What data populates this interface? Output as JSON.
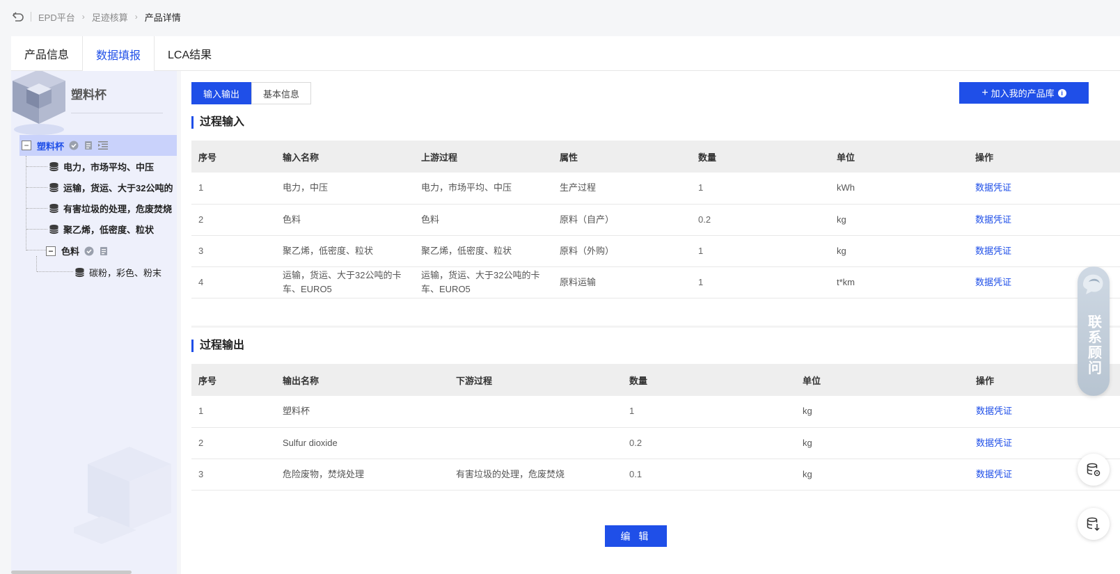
{
  "breadcrumb": {
    "items": [
      "EPD平台",
      "足迹核算",
      "产品详情"
    ]
  },
  "tabs": [
    {
      "label": "产品信息",
      "active": false
    },
    {
      "label": "数据填报",
      "active": true
    },
    {
      "label": "LCA结果",
      "active": false
    }
  ],
  "sidebar": {
    "title": "塑料杯",
    "root": {
      "label": "塑料杯"
    },
    "items": [
      {
        "label": "电力，市场平均、中压",
        "icon": "database-icon"
      },
      {
        "label": "运输，货运、大于32公吨的",
        "icon": "database-icon"
      },
      {
        "label": "有害垃圾的处理，危废焚烧",
        "icon": "database-icon"
      },
      {
        "label": "聚乙烯，低密度、粒状",
        "icon": "database-icon"
      },
      {
        "label": "色料",
        "icon": "expand-box"
      },
      {
        "label": "碳粉，彩色、粉末",
        "icon": "database-icon"
      }
    ]
  },
  "subtabs": [
    {
      "label": "输入输出",
      "active": true
    },
    {
      "label": "基本信息",
      "active": false
    }
  ],
  "add_button": {
    "label": "加入我的产品库"
  },
  "inputs": {
    "title": "过程输入",
    "columns": [
      "序号",
      "输入名称",
      "上游过程",
      "属性",
      "数量",
      "单位",
      "操作"
    ],
    "rows": [
      {
        "no": "1",
        "name": "电力，中压",
        "upstream": "电力，市场平均、中压",
        "attr": "生产过程",
        "qty": "1",
        "unit": "kWh",
        "action": "数据凭证"
      },
      {
        "no": "2",
        "name": "色料",
        "upstream": "色料",
        "attr": "原料（自产）",
        "qty": "0.2",
        "unit": "kg",
        "action": "数据凭证"
      },
      {
        "no": "3",
        "name": "聚乙烯，低密度、粒状",
        "upstream": "聚乙烯，低密度、粒状",
        "attr": "原料（外购）",
        "qty": "1",
        "unit": "kg",
        "action": "数据凭证"
      },
      {
        "no": "4",
        "name": "运输，货运、大于32公吨的卡车、EURO5",
        "upstream": "运输，货运、大于32公吨的卡车、EURO5",
        "attr": "原料运输",
        "qty": "1",
        "unit": "t*km",
        "action": "数据凭证"
      }
    ]
  },
  "outputs": {
    "title": "过程输出",
    "columns": [
      "序号",
      "输出名称",
      "下游过程",
      "数量",
      "单位",
      "操作"
    ],
    "rows": [
      {
        "no": "1",
        "name": "塑料杯",
        "downstream": "",
        "qty": "1",
        "unit": "kg",
        "action": "数据凭证"
      },
      {
        "no": "2",
        "name": "Sulfur dioxide",
        "downstream": "",
        "qty": "0.2",
        "unit": "kg",
        "action": "数据凭证"
      },
      {
        "no": "3",
        "name": "危险废物，焚烧处理",
        "downstream": "有害垃圾的处理，危废焚烧",
        "qty": "0.1",
        "unit": "kg",
        "action": "数据凭证"
      }
    ]
  },
  "edit_button": {
    "label": "编 辑"
  },
  "contact": {
    "label": "联系顾问"
  },
  "colors": {
    "accent": "#1f4fe8",
    "sidebar_bg": "#eef0fb",
    "selected_bg": "#c9d2fb"
  }
}
